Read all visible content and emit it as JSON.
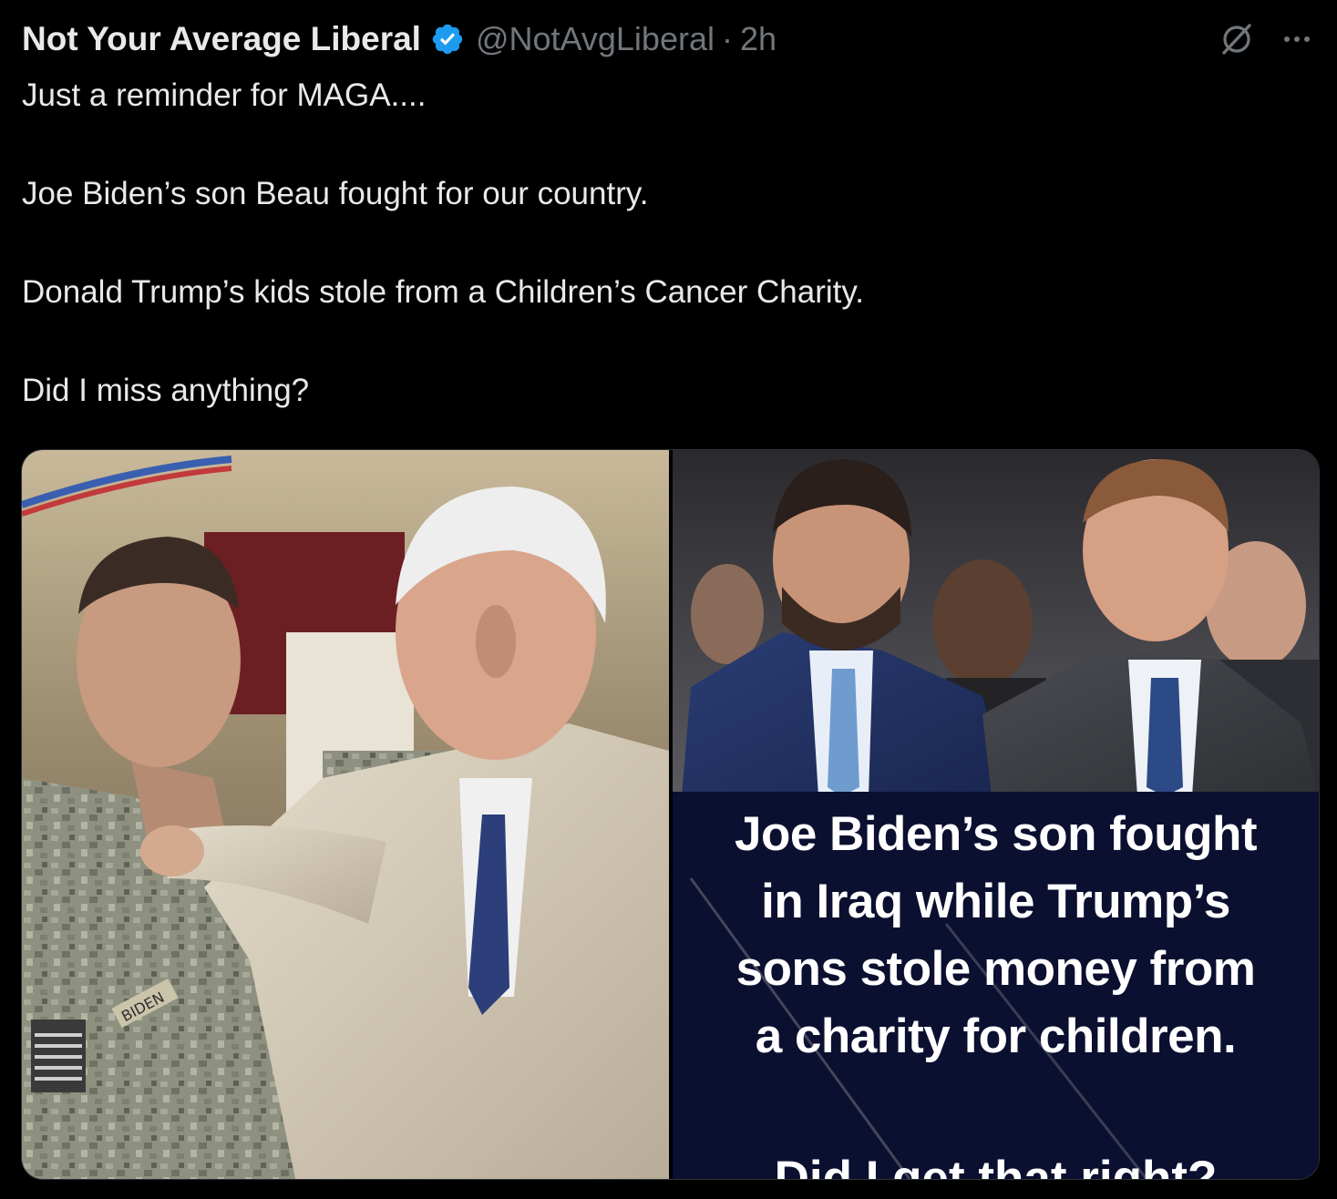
{
  "tweet": {
    "display_name": "Not Your Average Liberal",
    "handle": "@NotAvgLiberal",
    "separator": "·",
    "time": "2h",
    "verified": true,
    "verified_color": "#1d9bf0",
    "paragraphs": [
      "Just a reminder for MAGA....",
      "Joe Biden’s son Beau fought for our country.",
      "Donald Trump’s kids stole from a Children’s Cancer Charity.",
      "Did I miss anything?"
    ]
  },
  "header_actions": {
    "grok_icon": "grok-icon",
    "more_icon": "more-icon"
  },
  "media": {
    "left_image": {
      "subject": "Man in tan suit with hand on shoulder of soldier in camouflage uniform",
      "name_tape": "BIDEN"
    },
    "right_image": {
      "subject": "Two men in suits seated in a crowd",
      "overlay_lines": [
        "Joe Biden’s son fought",
        "in Iraq while Trump’s",
        "sons stole money from",
        "a charity for children."
      ],
      "overlay_footer": "Did I get that right?"
    }
  },
  "colors": {
    "background": "#000000",
    "text_primary": "#e7e9ea",
    "text_secondary": "#71767b",
    "border": "#2f3336",
    "overlay_bg": "#0b1030"
  }
}
